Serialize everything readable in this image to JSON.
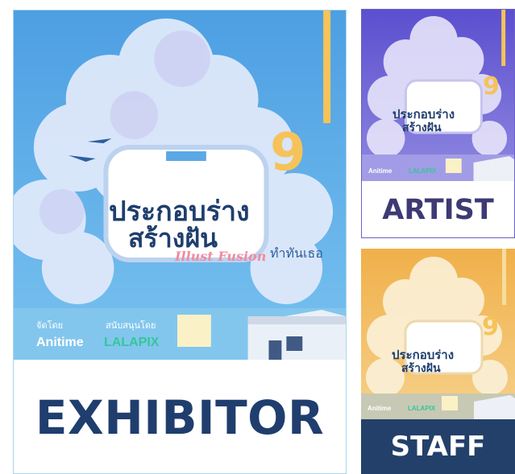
{
  "cards": [
    {
      "role": "EXHIBITOR"
    },
    {
      "role": "ARTIST"
    },
    {
      "role": "STAFF"
    }
  ],
  "poster": {
    "title_line1": "ประกอบร่าง",
    "title_line2": "สร้างฝัน",
    "edition": "9",
    "subtitle": "Illust Fusion",
    "tagline": "ทำทันเธอ",
    "organizer_label": "จัดโดย",
    "sponsor_label": "สนับสนุนโดย",
    "organizer_logo": "Anitime",
    "sponsor_logo": "LALAPIX"
  },
  "colors": {
    "exhibitor_bg": "#5aa9e6",
    "artist_bg": "#6b5fd6",
    "staff_bg": "#e9a84a",
    "navy": "#1f3e6e",
    "accent_yellow": "#f5c35a"
  }
}
